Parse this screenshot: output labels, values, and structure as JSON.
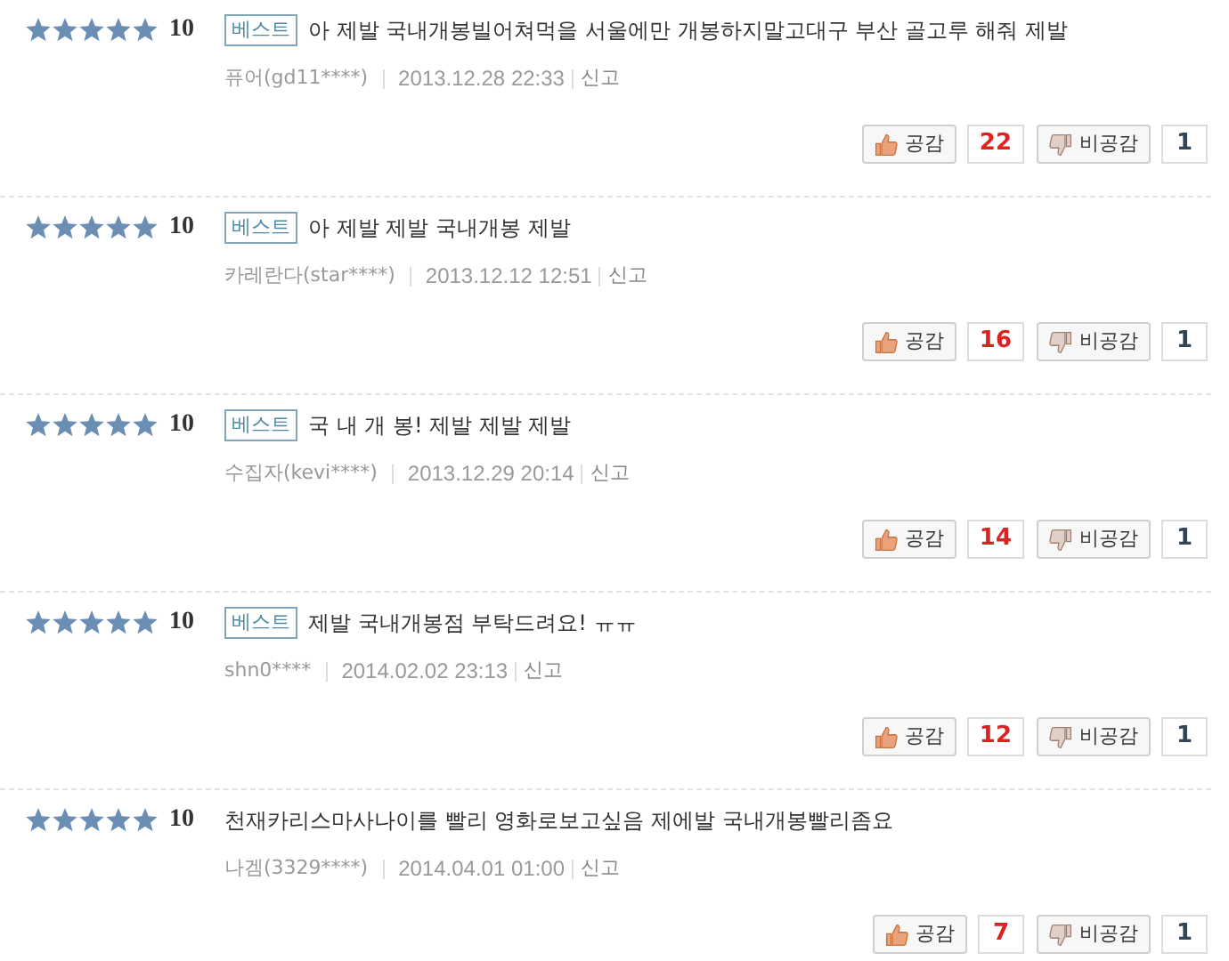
{
  "reviews": [
    {
      "stars": 5,
      "score": "10",
      "best": true,
      "badge": "베스트",
      "text": "아 제발 국내개봉빌어쳐먹을 서울에만 개봉하지말고대구 부산 골고루 해줘 제발",
      "author": "퓨어(gd11****)",
      "date": "2013.12.28 22:33",
      "report": "신고",
      "like_label": "공감",
      "like_count": "22",
      "dislike_label": "비공감",
      "dislike_count": "1"
    },
    {
      "stars": 5,
      "score": "10",
      "best": true,
      "badge": "베스트",
      "text": "아 제발 제발 국내개봉 제발",
      "author": "카레란다(star****)",
      "date": "2013.12.12 12:51",
      "report": "신고",
      "like_label": "공감",
      "like_count": "16",
      "dislike_label": "비공감",
      "dislike_count": "1"
    },
    {
      "stars": 5,
      "score": "10",
      "best": true,
      "badge": "베스트",
      "text": "국 내 개 봉! 제발 제발 제발",
      "author": "수집자(kevi****)",
      "date": "2013.12.29 20:14",
      "report": "신고",
      "like_label": "공감",
      "like_count": "14",
      "dislike_label": "비공감",
      "dislike_count": "1"
    },
    {
      "stars": 5,
      "score": "10",
      "best": true,
      "badge": "베스트",
      "text": "제발 국내개봉점 부탁드려요! ㅠㅠ",
      "author": "shn0****",
      "date": "2014.02.02 23:13",
      "report": "신고",
      "like_label": "공감",
      "like_count": "12",
      "dislike_label": "비공감",
      "dislike_count": "1"
    },
    {
      "stars": 5,
      "score": "10",
      "best": false,
      "text": "천재카리스마사나이를 빨리 영화로보고싶음 제에발 국내개봉빨리좀요",
      "author": "나겜(3329****)",
      "date": "2014.04.01 01:00",
      "report": "신고",
      "like_label": "공감",
      "like_count": "7",
      "dislike_label": "비공감",
      "dislike_count": "1"
    }
  ]
}
